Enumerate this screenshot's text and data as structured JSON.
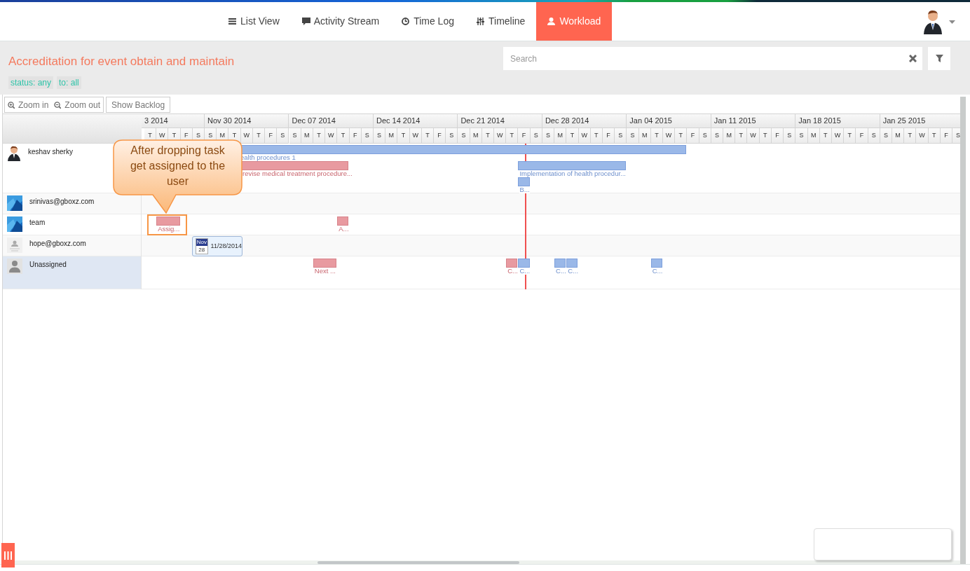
{
  "tabs": [
    {
      "label": "List View",
      "selected": false
    },
    {
      "label": "Activity Stream",
      "selected": false
    },
    {
      "label": "Time Log",
      "selected": false
    },
    {
      "label": "Timeline",
      "selected": false
    },
    {
      "label": "Workload",
      "selected": true
    }
  ],
  "project": {
    "title": "Accreditation for event obtain and maintain",
    "filters": [
      "status: any",
      "to: all"
    ]
  },
  "search": {
    "placeholder": "Search"
  },
  "toolbar": {
    "zoom_buttons": [
      "Zoom in",
      "Zoom out"
    ],
    "backlog_button": "Show Backlog"
  },
  "gantt": {
    "weeks": [
      {
        "label": "3 2014",
        "days": [
          "T",
          "W",
          "T",
          "F",
          "S"
        ]
      },
      {
        "label": "Nov 30 2014",
        "days": [
          "S",
          "M",
          "T",
          "W",
          "T",
          "F",
          "S"
        ]
      },
      {
        "label": "Dec 07 2014",
        "days": [
          "S",
          "M",
          "T",
          "W",
          "T",
          "F",
          "S"
        ]
      },
      {
        "label": "Dec 14 2014",
        "days": [
          "S",
          "M",
          "T",
          "W",
          "T",
          "F",
          "S"
        ]
      },
      {
        "label": "Dec 21 2014",
        "days": [
          "S",
          "M",
          "T",
          "W",
          "T",
          "F",
          "S"
        ]
      },
      {
        "label": "Dec 28 2014",
        "days": [
          "S",
          "M",
          "T",
          "W",
          "T",
          "F",
          "S"
        ]
      },
      {
        "label": "Jan 04 2015",
        "days": [
          "S",
          "M",
          "T",
          "W",
          "T",
          "F",
          "S"
        ]
      },
      {
        "label": "Jan 11 2015",
        "days": [
          "S",
          "M",
          "T",
          "W",
          "T",
          "F",
          "S"
        ]
      },
      {
        "label": "Jan 18 2015",
        "days": [
          "S",
          "M",
          "T",
          "W",
          "T",
          "F",
          "S"
        ]
      },
      {
        "label": "Jan 25 2015",
        "days": [
          "S",
          "M",
          "T",
          "W",
          "T",
          "F",
          "S"
        ]
      }
    ],
    "rows": [
      {
        "name": "keshav sherky",
        "kind": "person",
        "selected": false,
        "tasks": [
          {
            "label": "ealth procedures 1",
            "color": "#9ab8e8",
            "highlighted": false
          },
          {
            "label": "revise medical treatment procedure...",
            "color": "#e89aa0",
            "highlighted": false
          },
          {
            "label": "Implementation of health procedur...",
            "color": "#9ab8e8",
            "highlighted": false
          },
          {
            "label": "B...",
            "color": "#9ab8e8",
            "highlighted": false
          }
        ]
      },
      {
        "name": "srinivas@gboxz.com",
        "kind": "picture",
        "selected": false
      },
      {
        "name": "team",
        "kind": "picture",
        "selected": false,
        "tasks": [
          {
            "label": "Assig...",
            "color": "#e89aa0",
            "highlighted": true
          },
          {
            "label": "A...",
            "color": "#e89aa0",
            "highlighted": false
          }
        ]
      },
      {
        "name": "hope@gboxz.com",
        "kind": "pending",
        "selected": false
      },
      {
        "name": "Unassigned",
        "kind": "silhouette",
        "selected": true,
        "tasks": [
          {
            "label": "Next ...",
            "color": "#e89aa0",
            "highlighted": false
          },
          {
            "label": "C...",
            "color": "#e89aa0",
            "highlighted": false
          },
          {
            "label": "C...",
            "color": "#9ab8e8",
            "highlighted": false
          },
          {
            "label": "C...",
            "color": "#9ab8e8",
            "highlighted": false
          },
          {
            "label": "C...",
            "color": "#9ab8e8",
            "highlighted": false
          },
          {
            "label": "C...",
            "color": "#9ab8e8",
            "highlighted": false
          }
        ]
      }
    ],
    "drag_tooltip": {
      "month": "Nov",
      "day": "28",
      "date": "11/28/2014"
    },
    "callout": "After dropping task get assigned to the user"
  }
}
